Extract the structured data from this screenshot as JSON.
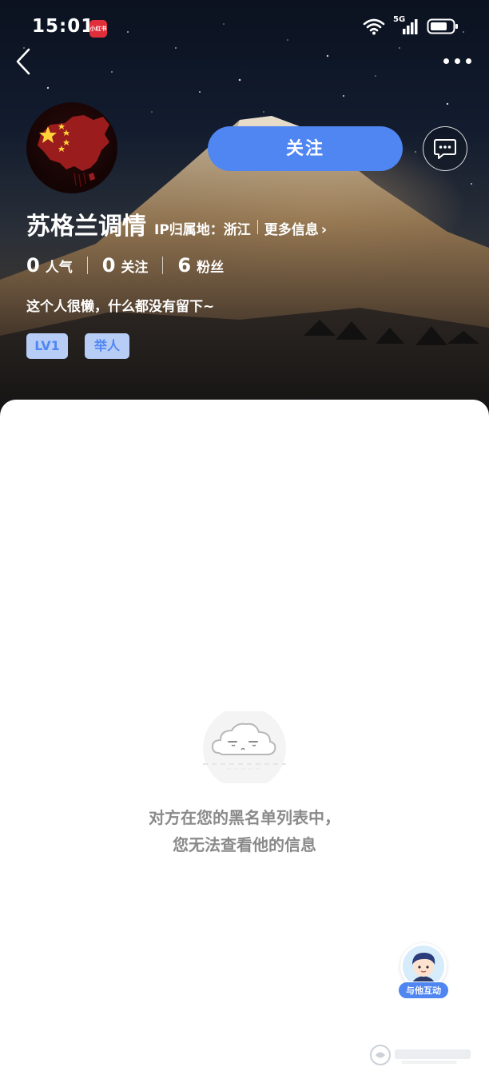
{
  "status_bar": {
    "time": "15:01",
    "app_badge": "小红书",
    "network": "5G",
    "icons": [
      "wifi-icon",
      "cellular-signal-icon",
      "battery-icon"
    ]
  },
  "nav": {
    "back_icon": "chevron-left-icon",
    "more_icon": "more-dots-icon"
  },
  "profile": {
    "username": "苏格兰调情",
    "ip_location": "IP归属地：浙江",
    "more_info": "更多信息",
    "follow_label": "关注",
    "message_icon": "chat-bubble-icon",
    "stats": [
      {
        "num": "0",
        "label": "人气"
      },
      {
        "num": "0",
        "label": "关注"
      },
      {
        "num": "6",
        "label": "粉丝"
      }
    ],
    "bio": "这个人很懒，什么都没有留下~",
    "level_tag": "LV1",
    "report_tag": "举人"
  },
  "content": {
    "blocked_line1": "对方在您的黑名单列表中，",
    "blocked_line2": "您无法查看他的信息",
    "interact_label": "与他互动"
  },
  "colors": {
    "accent": "#4f86f2",
    "tag_bg": "#b8cdf6",
    "muted_text": "#8a8a8a"
  }
}
